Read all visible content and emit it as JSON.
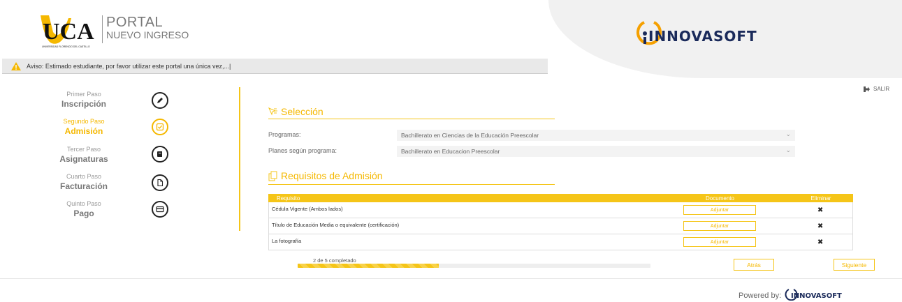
{
  "header": {
    "portal_title": "PORTAL",
    "portal_subtitle": "NUEVO INGRESO",
    "logo_text": "UCA",
    "logo_subtext": "UNIVERSIDAD FLORENCIO DEL CASTILLO",
    "brand_logo_text": "INNOVASOFT"
  },
  "notice": {
    "icon": "warning-icon",
    "text": "Aviso: Estimado estudiante, por favor utilizar este portal una única vez,...|"
  },
  "salir": {
    "label": "SALIR",
    "icon": "logout-icon"
  },
  "steps": [
    {
      "sub": "Primer Paso",
      "main": "Inscripción",
      "icon": "pencil-icon",
      "active": false
    },
    {
      "sub": "Segundo Paso",
      "main": "Admisión",
      "icon": "checkbox-icon",
      "active": true
    },
    {
      "sub": "Tercer Paso",
      "main": "Asignaturas",
      "icon": "book-icon",
      "active": false
    },
    {
      "sub": "Cuarto Paso",
      "main": "Facturación",
      "icon": "document-icon",
      "active": false
    },
    {
      "sub": "Quinto Paso",
      "main": "Pago",
      "icon": "credit-card-icon",
      "active": false
    }
  ],
  "seleccion": {
    "title": "Selección",
    "programas_label": "Programas:",
    "programas_value": "Bachillerato en Ciencias de la Educación Preescolar",
    "planes_label": "Planes según programa:",
    "planes_value": "Bachillerato en Educacion Preescolar"
  },
  "requisitos": {
    "title": "Requisitos de Admisión",
    "columns": [
      "Requisito",
      "Documento",
      "Eliminar"
    ],
    "rows": [
      {
        "requisito": "Cédula Vigente (Ambos lados)",
        "action": "Adjuntar"
      },
      {
        "requisito": "Título de Educación Media o equivalente (certificación)",
        "action": "Adjuntar"
      },
      {
        "requisito": "La fotografía",
        "action": "Adjuntar"
      }
    ],
    "delete_symbol": "✖"
  },
  "progress": {
    "label": "2 de 5 completado",
    "fraction": 0.4
  },
  "nav": {
    "back": "Atrás",
    "next": "Siguiente"
  },
  "footer": {
    "powered_by": "Powered by:"
  },
  "colors": {
    "accent": "#f5c518",
    "accent_text": "#f5b800"
  }
}
